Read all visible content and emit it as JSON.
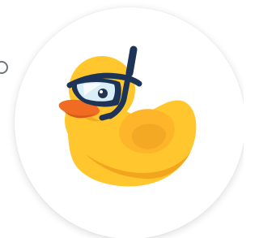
{
  "image": {
    "subject_icon": "duck-with-snorkel-icon",
    "side_icon": "circle-icon"
  },
  "colors": {
    "background": "#ffffff",
    "duck_body": "#ffc62d",
    "duck_shadow": "#f3a61d",
    "beak": "#f06c22",
    "snorkel": "#1d3456",
    "mask_lens": "#d9eef7"
  }
}
